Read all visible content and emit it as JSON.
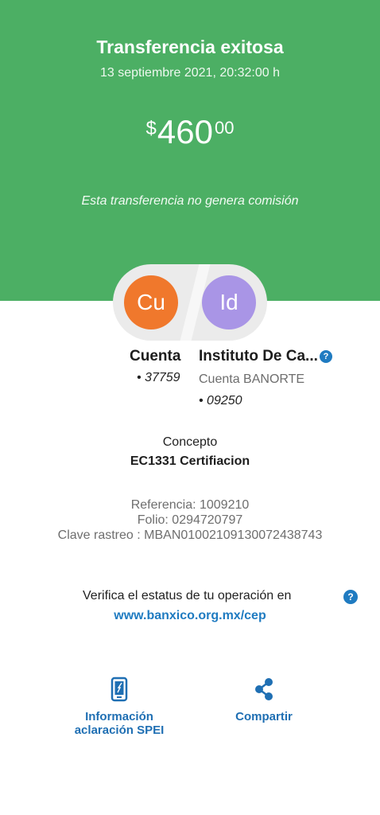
{
  "header": {
    "title": "Transferencia exitosa",
    "datetime": "13 septiembre 2021, 20:32:00 h",
    "amount": {
      "currency": "$",
      "integer": "460",
      "decimals": "00"
    },
    "fee_note": "Esta transferencia no genera comisión",
    "color": "#4caf64"
  },
  "origin": {
    "initials": "Cu",
    "name": "Cuenta",
    "account": "• 37759",
    "avatar_color": "#f0782c"
  },
  "destination": {
    "initials": "Id",
    "name": "Instituto De Ca...",
    "bank": "Cuenta BANORTE",
    "account": "• 09250",
    "avatar_color": "#a995e6"
  },
  "concept": {
    "label": "Concepto",
    "value": "EC1331 Certifiacion"
  },
  "references": {
    "referencia": "Referencia: 1009210",
    "folio": "Folio: 0294720797",
    "clave_rastreo": "Clave rastreo : MBAN01002109130072438743"
  },
  "verify": {
    "text": "Verifica el estatus de tu operación en",
    "link": "www.banxico.org.mx/cep"
  },
  "help_glyph": "?",
  "actions": {
    "spei_line1": "Información",
    "spei_line2": "aclaración SPEI",
    "share": "Compartir"
  },
  "icons": {
    "help": "help-icon",
    "phone": "phone-icon",
    "share": "share-icon"
  },
  "accent_color": "#1f7bc1"
}
